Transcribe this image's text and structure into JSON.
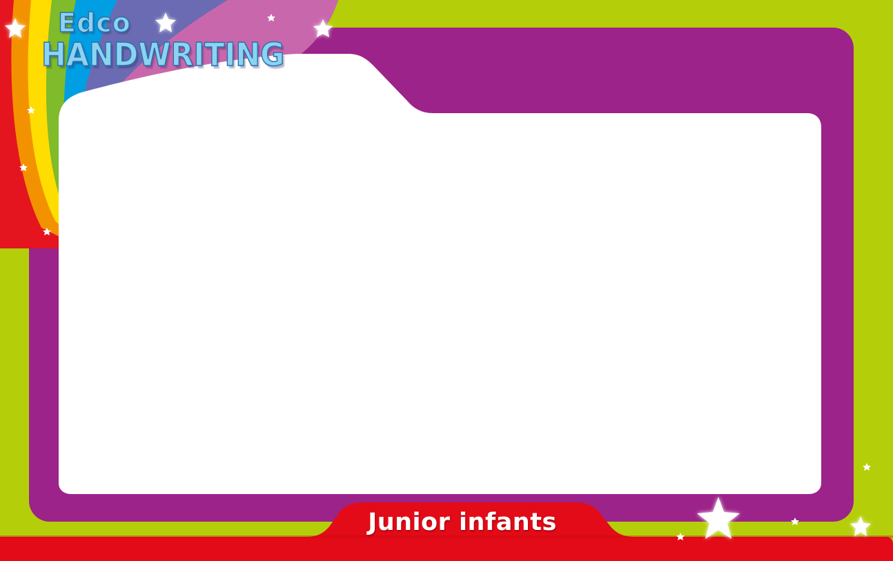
{
  "logo": {
    "brand": "Edco",
    "product": "HANDWRITING"
  },
  "footer": {
    "grade_label": "Junior infants"
  },
  "colors": {
    "background_green": "#b5ce0a",
    "frame_purple": "#9c238a",
    "panel_white": "#ffffff",
    "footer_red": "#e30b17",
    "logo_blue": "#8bd3ef",
    "rainbow": [
      "#e4151f",
      "#f39200",
      "#ffdd00",
      "#7fbb2a",
      "#009fe3",
      "#6a6bb3",
      "#c967ac"
    ]
  },
  "icons": [
    "star-icon"
  ]
}
